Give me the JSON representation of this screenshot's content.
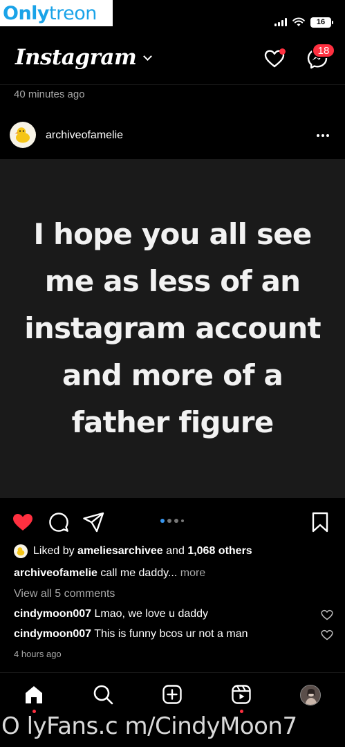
{
  "watermark": {
    "top_part1": "Only",
    "top_part2": "treon",
    "bottom": "O lyFans.c m/CindyMoon7"
  },
  "status_bar": {
    "battery": "16"
  },
  "header": {
    "app_title": "Instagram",
    "messages_badge": "18"
  },
  "feed": {
    "previous_post_time": "40 minutes ago"
  },
  "post": {
    "username": "archiveofamelie",
    "image_text": [
      "I hope you all see",
      "me as less of an",
      "instagram account",
      "and more of a",
      "father figure"
    ],
    "liked_by_prefix": "Liked by",
    "liked_by_user": "ameliesarchivee",
    "liked_by_and": "and",
    "likes_others": "1,068 others",
    "caption_user": "archiveofamelie",
    "caption_text": "call me daddy...",
    "caption_more": "more",
    "view_comments": "View all 5 comments",
    "comments": [
      {
        "user": "cindymoon007",
        "text": "Lmao, we love u daddy"
      },
      {
        "user": "cindymoon007",
        "text": "This is funny bcos ur not a man"
      }
    ],
    "timestamp": "4 hours ago",
    "carousel_dots": 4
  },
  "colors": {
    "accent_red": "#ff3040",
    "watermark_blue": "#1aa3e8",
    "muted_text": "#a8a8a8"
  }
}
